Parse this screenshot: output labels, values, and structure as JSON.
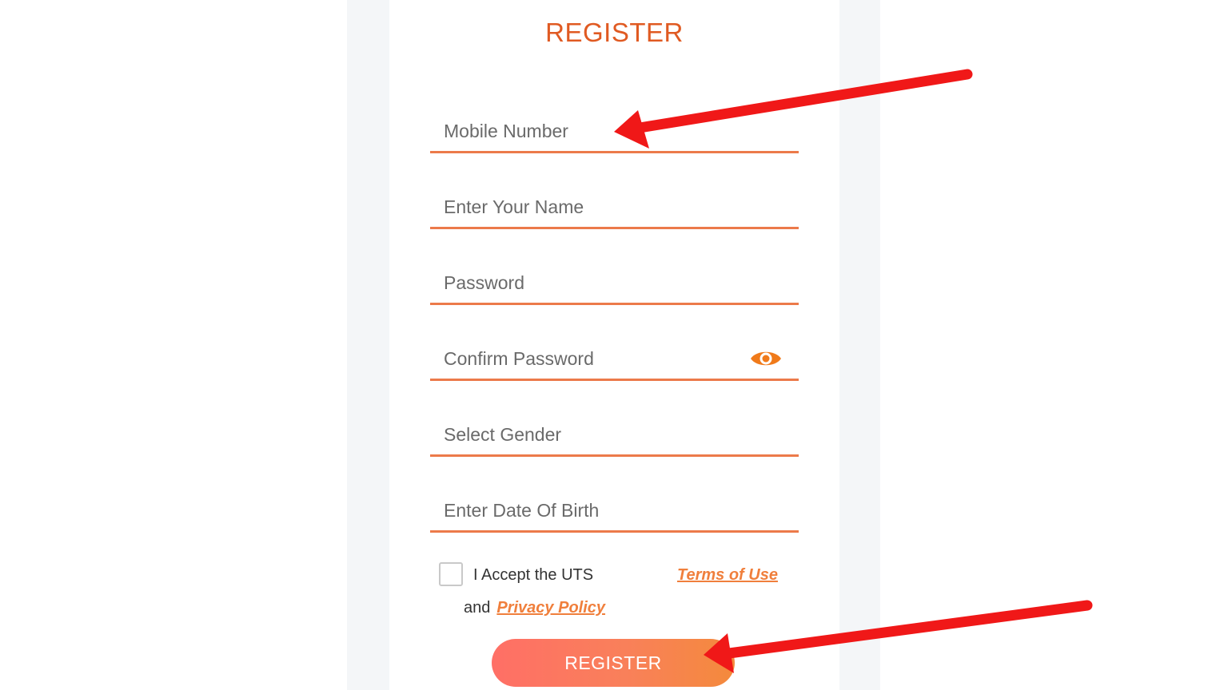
{
  "form": {
    "title": "REGISTER",
    "fields": {
      "mobile": {
        "placeholder": "Mobile Number",
        "value": ""
      },
      "name": {
        "placeholder": "Enter Your Name",
        "value": ""
      },
      "password": {
        "placeholder": "Password",
        "value": ""
      },
      "confirm_password": {
        "placeholder": "Confirm Password",
        "value": ""
      },
      "gender": {
        "placeholder": "Select Gender",
        "value": ""
      },
      "dob": {
        "placeholder": "Enter Date Of Birth",
        "value": ""
      }
    },
    "terms": {
      "accept_text": "I Accept the UTS",
      "terms_link": "Terms of Use",
      "and_text": "and",
      "privacy_link": "Privacy Policy",
      "checked": false
    },
    "submit_label": "REGISTER"
  },
  "icons": {
    "password_toggle": "eye-icon"
  },
  "colors": {
    "accent": "#e05a22",
    "underline": "#ec7a4a",
    "link": "#f07f3c",
    "button_start": "#ff6f66",
    "button_end": "#f48a3c",
    "annotation_arrow": "#f01818"
  }
}
